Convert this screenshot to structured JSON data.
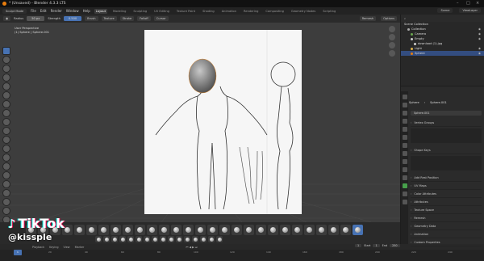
{
  "window": {
    "title": "* (Unsaved) - Blender 4.3.3 LTS"
  },
  "menubar": {
    "mode": "Sculpt Mode",
    "items": [
      "File",
      "Edit",
      "Render",
      "Window",
      "Help"
    ],
    "workspace_tabs": [
      "Layout",
      "Modeling",
      "Sculpting",
      "UV Editing",
      "Texture Paint",
      "Shading",
      "Animation",
      "Rendering",
      "Compositing",
      "Geometry Nodes",
      "Scripting"
    ],
    "active_tab": "Layout",
    "scene": "Scene",
    "view_layer": "ViewLayer"
  },
  "tool_header": {
    "view": "View",
    "sculpt": "Sculpt",
    "mask": "Mask",
    "face_sets": "Face Sets",
    "radius_label": "Radius",
    "radius_value": "50 px",
    "strength_label": "Strength",
    "strength_value": "0.500",
    "brush": "Brush",
    "texture": "Texture",
    "stroke": "Stroke",
    "falloff": "Falloff",
    "cursor": "Cursor",
    "remesh": "Remesh",
    "options": "Options"
  },
  "viewport": {
    "view_name": "User Perspective",
    "object_info": "(1) Sphere | Sphere.001"
  },
  "outliner": {
    "header": "Scene Collection",
    "items": [
      {
        "label": "Collection",
        "color": "#aaaaaa",
        "selected": false
      },
      {
        "label": "Camera",
        "color": "#6aa84f",
        "selected": false
      },
      {
        "label": "Empty",
        "color": "#cccccc",
        "selected": false
      },
      {
        "label": "download (1).jpg",
        "color": "#cccccc",
        "selected": false
      },
      {
        "label": "Light",
        "color": "#e0b44a",
        "selected": false
      },
      {
        "label": "Sphere",
        "color": "#e87d0d",
        "selected": true
      }
    ]
  },
  "properties": {
    "object": "Sphere",
    "mesh": "Sphere.001",
    "mesh_field": "Sphere.001",
    "sections": [
      "Vertex Groups",
      "Shape Keys",
      "Add Rest Position",
      "UV Maps",
      "Color Attributes",
      "Attributes",
      "Texture Space",
      "Remesh",
      "Geometry Data",
      "Animation",
      "Custom Properties"
    ]
  },
  "timeline": {
    "playback": "Playback",
    "keying": "Keying",
    "view": "View",
    "marker": "Marker",
    "current_frame": "1",
    "start_label": "Start",
    "start": "1",
    "end_label": "End",
    "end": "250",
    "ticks": [
      "20",
      "40",
      "60",
      "80",
      "100",
      "120",
      "140",
      "160",
      "180",
      "200",
      "220",
      "240"
    ]
  },
  "watermark": {
    "brand": "TikTok",
    "handle": "@kissple"
  }
}
